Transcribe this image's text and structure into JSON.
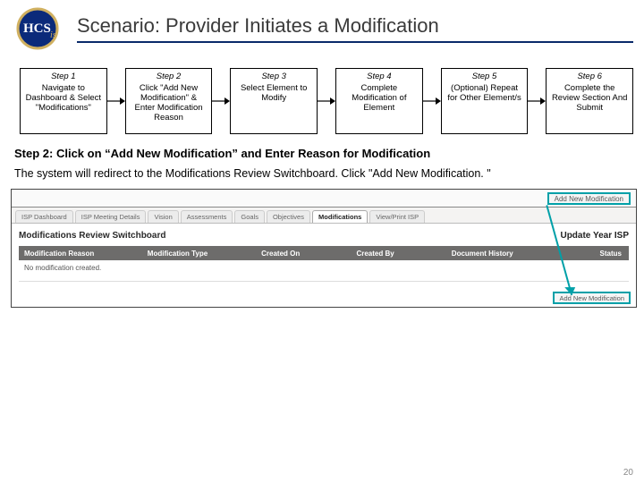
{
  "header": {
    "title": "Scenario: Provider Initiates a Modification",
    "logo_primary_text": "HCS",
    "logo_sub_text": "is"
  },
  "steps": [
    {
      "title": "Step 1",
      "desc": "Navigate to Dashboard & Select \"Modifications\""
    },
    {
      "title": "Step 2",
      "desc": "Click \"Add New Modification\" & Enter Modification Reason"
    },
    {
      "title": "Step 3",
      "desc": "Select Element to Modify"
    },
    {
      "title": "Step 4",
      "desc": "Complete Modification of Element"
    },
    {
      "title": "Step 5",
      "desc": "(Optional) Repeat for Other Element/s"
    },
    {
      "title": "Step 6",
      "desc": "Complete the Review Section And Submit"
    }
  ],
  "instruction": "Step 2: Click on “Add New Modification” and Enter Reason for Modification",
  "body": "The system will redirect to the Modifications Review Switchboard. Click \"Add New Modification. \"",
  "screenshot": {
    "top_button": "Add New Modification",
    "tabs": {
      "items": [
        "ISP Dashboard",
        "ISP Meeting Details",
        "Vision",
        "Assessments",
        "Goals",
        "Objectives",
        "Modifications",
        "View/Print ISP"
      ],
      "active_index": 6
    },
    "panel_title": "Modifications Review Switchboard",
    "panel_right": "Update Year ISP",
    "columns": [
      "Modification Reason",
      "Modification Type",
      "Created On",
      "Created By",
      "Document History",
      "Status"
    ],
    "empty_row": "No modification created.",
    "bottom_button": "Add New Modification"
  },
  "page_number": 20
}
